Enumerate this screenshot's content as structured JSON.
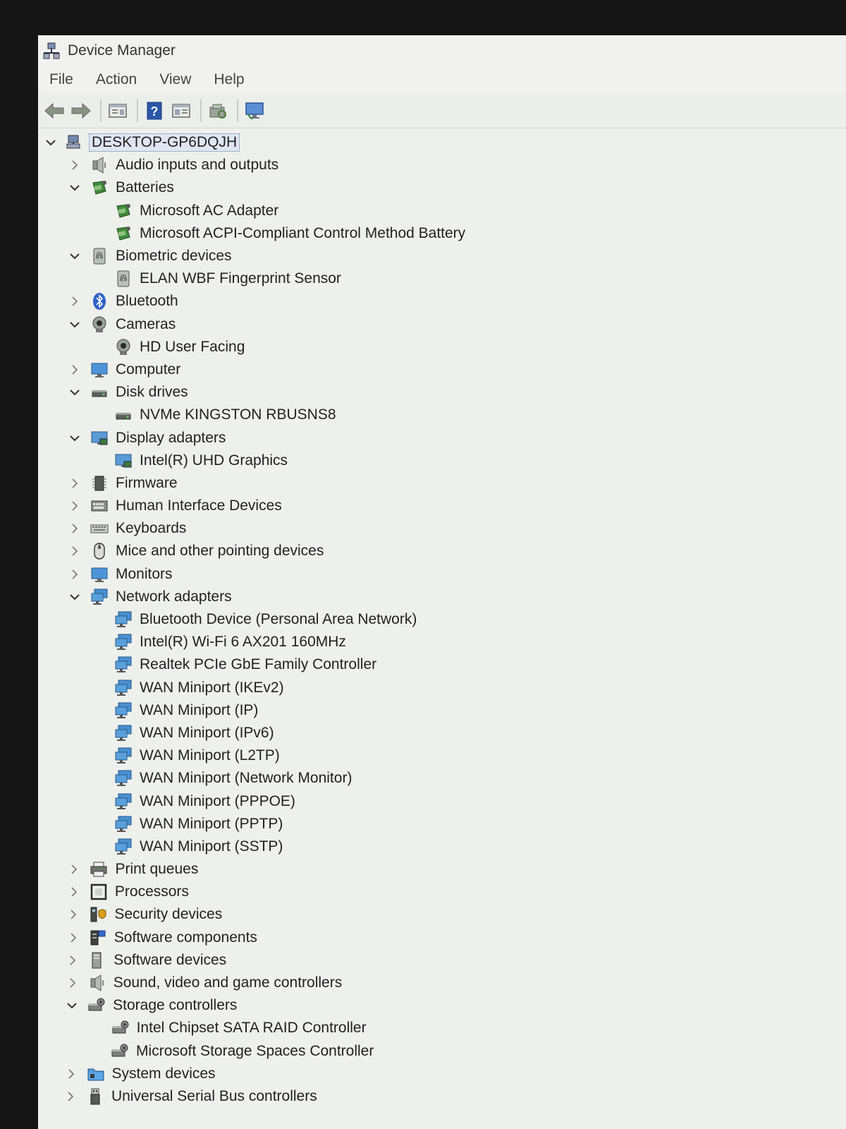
{
  "window": {
    "title": "Device Manager"
  },
  "menu": [
    "File",
    "Action",
    "View",
    "Help"
  ],
  "toolbar": [
    {
      "name": "back-arrow-icon",
      "kind": "back"
    },
    {
      "name": "forward-arrow-icon",
      "kind": "forward"
    },
    {
      "name": "sep"
    },
    {
      "name": "properties-icon",
      "kind": "props"
    },
    {
      "name": "sep"
    },
    {
      "name": "help-icon",
      "kind": "help"
    },
    {
      "name": "details-view-icon",
      "kind": "details"
    },
    {
      "name": "sep"
    },
    {
      "name": "scan-hardware-icon",
      "kind": "scan"
    },
    {
      "name": "sep"
    },
    {
      "name": "monitor-update-icon",
      "kind": "monitor"
    }
  ],
  "tree": [
    {
      "level": 0,
      "label": "DESKTOP-GP6DQJH",
      "icon": "computer",
      "expand": "open",
      "root": true
    },
    {
      "level": 1,
      "label": "Audio inputs and outputs",
      "icon": "speaker",
      "expand": "closed"
    },
    {
      "level": 1,
      "label": "Batteries",
      "icon": "battery",
      "expand": "open"
    },
    {
      "level": 2,
      "label": "Microsoft AC Adapter",
      "icon": "battery"
    },
    {
      "level": 2,
      "label": "Microsoft ACPI-Compliant Control Method Battery",
      "icon": "battery"
    },
    {
      "level": 1,
      "label": "Biometric devices",
      "icon": "fingerprint",
      "expand": "open"
    },
    {
      "level": 2,
      "label": "ELAN WBF Fingerprint Sensor",
      "icon": "fingerprint"
    },
    {
      "level": 1,
      "label": "Bluetooth",
      "icon": "bluetooth",
      "expand": "closed"
    },
    {
      "level": 1,
      "label": "Cameras",
      "icon": "camera",
      "expand": "open"
    },
    {
      "level": 2,
      "label": "HD User Facing",
      "icon": "camera"
    },
    {
      "level": 1,
      "label": "Computer",
      "icon": "monitor",
      "expand": "closed"
    },
    {
      "level": 1,
      "label": "Disk drives",
      "icon": "disk",
      "expand": "open"
    },
    {
      "level": 2,
      "label": "NVMe KINGSTON RBUSNS8",
      "icon": "disk"
    },
    {
      "level": 1,
      "label": "Display adapters",
      "icon": "display",
      "expand": "open"
    },
    {
      "level": 2,
      "label": "Intel(R) UHD Graphics",
      "icon": "display"
    },
    {
      "level": 1,
      "label": "Firmware",
      "icon": "chip",
      "expand": "closed"
    },
    {
      "level": 1,
      "label": "Human Interface Devices",
      "icon": "hid",
      "expand": "closed"
    },
    {
      "level": 1,
      "label": "Keyboards",
      "icon": "keyboard",
      "expand": "closed"
    },
    {
      "level": 1,
      "label": "Mice and other pointing devices",
      "icon": "mouse",
      "expand": "closed"
    },
    {
      "level": 1,
      "label": "Monitors",
      "icon": "monitor",
      "expand": "closed"
    },
    {
      "level": 1,
      "label": "Network adapters",
      "icon": "network",
      "expand": "open"
    },
    {
      "level": 2,
      "label": "Bluetooth Device (Personal Area Network)",
      "icon": "network"
    },
    {
      "level": 2,
      "label": "Intel(R) Wi-Fi 6 AX201 160MHz",
      "icon": "network"
    },
    {
      "level": 2,
      "label": "Realtek PCIe GbE Family Controller",
      "icon": "network"
    },
    {
      "level": 2,
      "label": "WAN Miniport (IKEv2)",
      "icon": "network"
    },
    {
      "level": 2,
      "label": "WAN Miniport (IP)",
      "icon": "network"
    },
    {
      "level": 2,
      "label": "WAN Miniport (IPv6)",
      "icon": "network"
    },
    {
      "level": 2,
      "label": "WAN Miniport (L2TP)",
      "icon": "network"
    },
    {
      "level": 2,
      "label": "WAN Miniport (Network Monitor)",
      "icon": "network"
    },
    {
      "level": 2,
      "label": "WAN Miniport (PPPOE)",
      "icon": "network"
    },
    {
      "level": 2,
      "label": "WAN Miniport (PPTP)",
      "icon": "network"
    },
    {
      "level": 2,
      "label": "WAN Miniport (SSTP)",
      "icon": "network"
    },
    {
      "level": 1,
      "label": "Print queues",
      "icon": "printer",
      "expand": "closed"
    },
    {
      "level": 1,
      "label": "Processors",
      "icon": "processor",
      "expand": "closed"
    },
    {
      "level": 1,
      "label": "Security devices",
      "icon": "security",
      "expand": "closed"
    },
    {
      "level": 1,
      "label": "Software components",
      "icon": "software",
      "expand": "closed"
    },
    {
      "level": 1,
      "label": "Software devices",
      "icon": "softdev",
      "expand": "closed"
    },
    {
      "level": 1,
      "label": "Sound, video and game controllers",
      "icon": "speaker",
      "expand": "closed"
    },
    {
      "level": 1,
      "label": "Storage controllers",
      "icon": "storage",
      "expand": "open"
    },
    {
      "level": 2,
      "label": "Intel Chipset SATA RAID Controller",
      "icon": "storage"
    },
    {
      "level": 2,
      "label": "Microsoft Storage Spaces Controller",
      "icon": "storage"
    },
    {
      "level": 1,
      "label": "System devices",
      "icon": "folder",
      "expand": "closed"
    },
    {
      "level": 1,
      "label": "Universal Serial Bus controllers",
      "icon": "usb",
      "expand": "closed"
    }
  ]
}
